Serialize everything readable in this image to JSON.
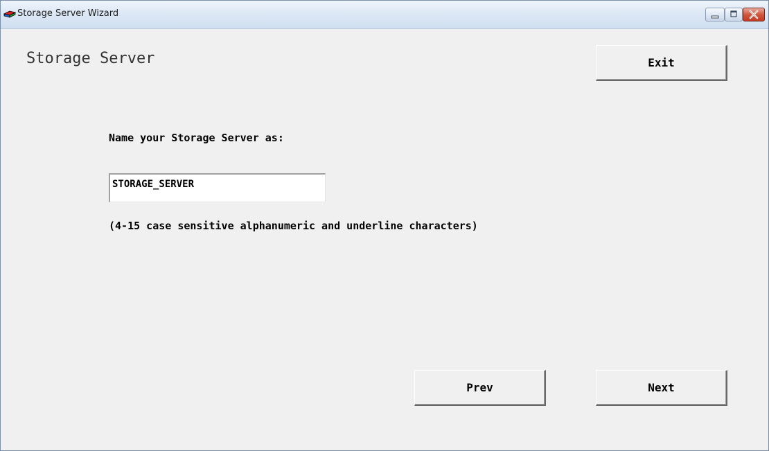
{
  "window": {
    "title": "Storage Server Wizard",
    "icon": "storage-server-icon"
  },
  "title_buttons": {
    "minimize_icon": "minimize-icon",
    "maximize_icon": "maximize-icon",
    "close_icon": "close-icon"
  },
  "page": {
    "heading": "Storage Server",
    "exit_label": "Exit",
    "name_label": "Name your Storage Server as:",
    "name_value": "STORAGE_SERVER",
    "hint": "(4-15 case sensitive alphanumeric and underline characters)",
    "prev_label": "Prev",
    "next_label": "Next"
  },
  "colors": {
    "window_bg": "#f0f0f0",
    "close_button": "#c43a24"
  }
}
